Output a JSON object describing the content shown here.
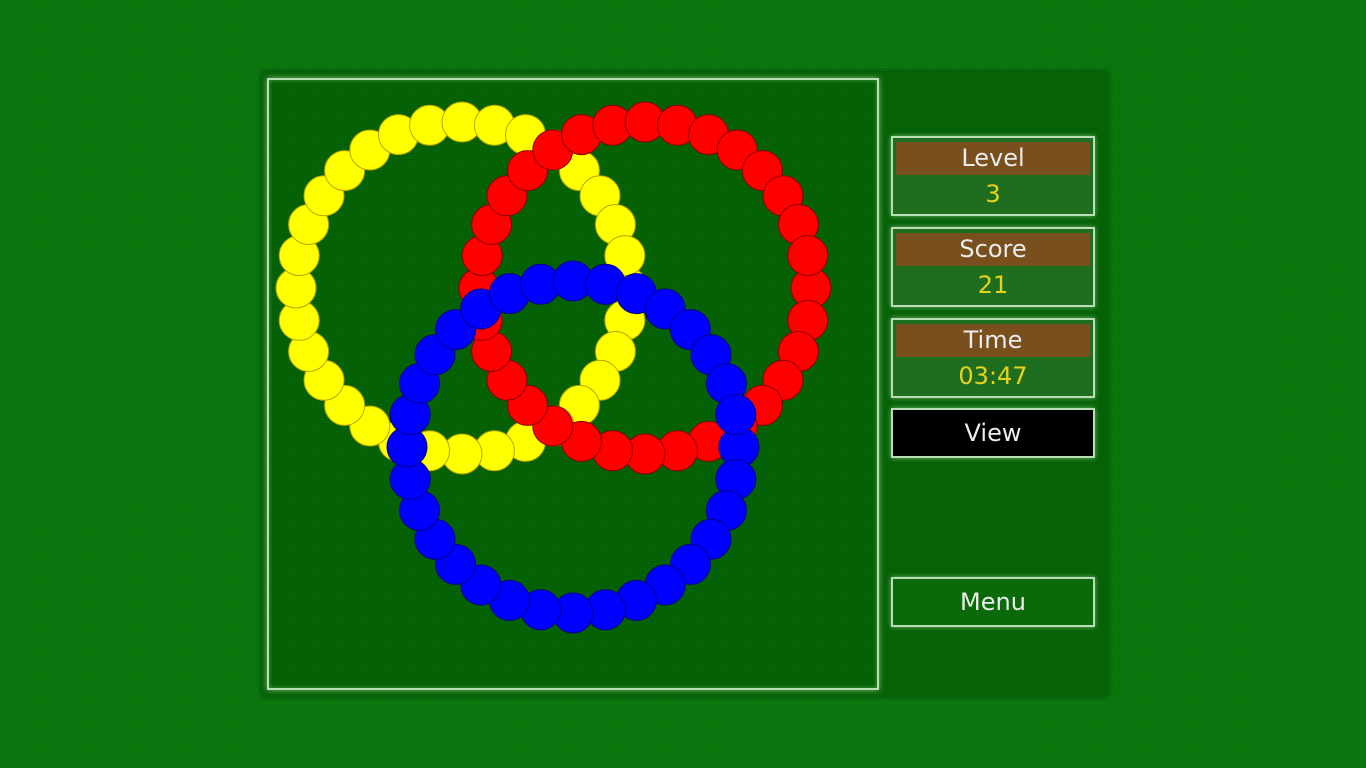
{
  "hud": {
    "level_label": "Level",
    "level_value": "3",
    "score_label": "Score",
    "score_value": "21",
    "time_label": "Time",
    "time_value": "03:47"
  },
  "buttons": {
    "view_label": "View",
    "menu_label": "Menu"
  },
  "colors": {
    "yellow": "#ffff00",
    "red": "#ff0000",
    "blue": "#0000ff",
    "label_bg": "#7a4f1e",
    "value_text": "#e8d21a"
  },
  "rings": [
    {
      "name": "yellow-ring",
      "balls": [
        "yellow",
        "yellow",
        "yellow",
        "yellow",
        "yellow",
        "yellow",
        "yellow",
        "yellow",
        "yellow",
        "yellow",
        "yellow",
        "yellow",
        "yellow",
        "yellow",
        "yellow",
        "yellow",
        "yellow",
        "yellow",
        "yellow",
        "yellow",
        "yellow",
        "yellow",
        "yellow",
        "yellow",
        "yellow",
        "yellow",
        "yellow",
        "yellow",
        "yellow",
        "yellow",
        "yellow",
        "yellow"
      ]
    },
    {
      "name": "red-ring",
      "balls": [
        "red",
        "red",
        "red",
        "red",
        "red",
        "red",
        "red",
        "red",
        "red",
        "red",
        "red",
        "red",
        "red",
        "red",
        "red",
        "red",
        "red",
        "red",
        "red",
        "red",
        "red",
        "red",
        "red",
        "red",
        "red",
        "red",
        "red",
        "red",
        "red",
        "red",
        "red",
        "red"
      ]
    },
    {
      "name": "blue-ring",
      "balls": [
        "blue",
        "blue",
        "blue",
        "blue",
        "blue",
        "blue",
        "blue",
        "blue",
        "blue",
        "blue",
        "blue",
        "blue",
        "blue",
        "blue",
        "blue",
        "blue",
        "blue",
        "blue",
        "blue",
        "blue",
        "blue",
        "blue",
        "blue",
        "blue",
        "blue",
        "blue",
        "blue",
        "blue",
        "blue",
        "blue",
        "blue",
        "blue"
      ]
    }
  ]
}
